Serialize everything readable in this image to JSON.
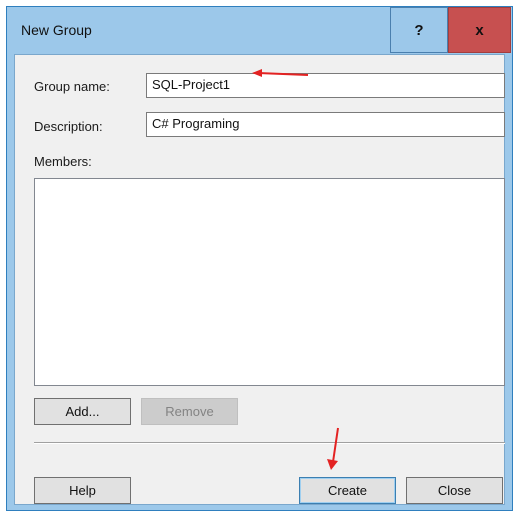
{
  "window": {
    "title": "New Group",
    "help_glyph": "?",
    "close_glyph": "x"
  },
  "form": {
    "group_name_label": "Group name:",
    "group_name_value": "SQL-Project1",
    "description_label": "Description:",
    "description_value": "C# Programing",
    "members_label": "Members:",
    "members": []
  },
  "buttons": {
    "add": "Add...",
    "remove": "Remove",
    "help": "Help",
    "create": "Create",
    "close": "Close"
  },
  "annotation": {
    "arrow_color": "#e32222"
  }
}
